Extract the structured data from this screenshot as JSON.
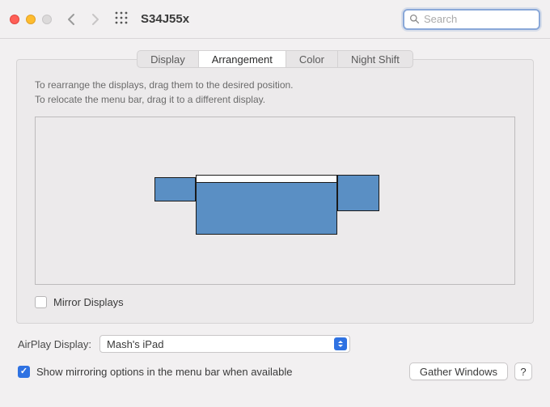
{
  "window": {
    "title": "S34J55x",
    "search_placeholder": "Search"
  },
  "tabs": {
    "items": [
      {
        "label": "Display",
        "active": false
      },
      {
        "label": "Arrangement",
        "active": true
      },
      {
        "label": "Color",
        "active": false
      },
      {
        "label": "Night Shift",
        "active": false
      }
    ]
  },
  "instructions": {
    "line1": "To rearrange the displays, drag them to the desired position.",
    "line2": "To relocate the menu bar, drag it to a different display."
  },
  "displays": {
    "color": "#5a8fc4",
    "items": [
      {
        "id": "left",
        "has_menubar": false
      },
      {
        "id": "main",
        "has_menubar": true
      },
      {
        "id": "right",
        "has_menubar": false
      }
    ]
  },
  "mirror": {
    "label": "Mirror Displays",
    "checked": false
  },
  "airplay": {
    "label": "AirPlay Display:",
    "selected": "Mash's iPad"
  },
  "menubar_option": {
    "label": "Show mirroring options in the menu bar when available",
    "checked": true
  },
  "buttons": {
    "gather": "Gather Windows",
    "help": "?"
  }
}
